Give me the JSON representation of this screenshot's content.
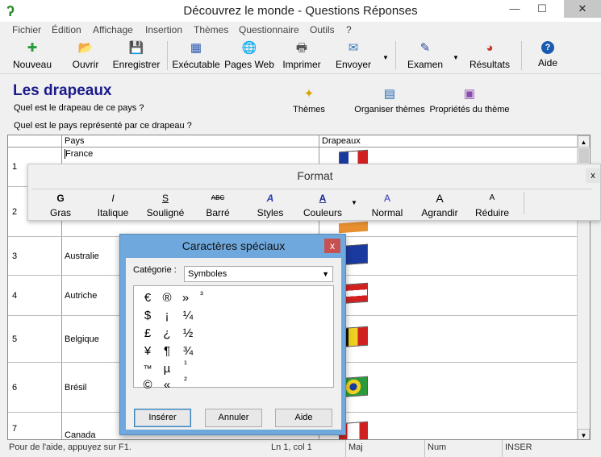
{
  "window": {
    "title": "Découvrez le monde - Questions Réponses",
    "minimize": "—",
    "maximize": "☐",
    "close": "✕"
  },
  "menu": [
    "Fichier",
    "Édition",
    "Affichage",
    "Insertion",
    "Thèmes",
    "Questionnaire",
    "Outils",
    "?"
  ],
  "toolbar": [
    {
      "label": "Nouveau",
      "icon": "new-icon",
      "glyph": "✚",
      "color": "#2a9a3a"
    },
    {
      "label": "Ouvrir",
      "icon": "open-folder-icon",
      "glyph": "📂",
      "color": "#d9a400"
    },
    {
      "label": "Enregistrer",
      "icon": "save-disk-icon",
      "glyph": "💾",
      "color": "#7b2a8a"
    },
    {
      "label": "Exécutable",
      "icon": "executable-icon",
      "glyph": "▦",
      "color": "#2a5ab0"
    },
    {
      "label": "Pages Web",
      "icon": "web-pages-icon",
      "glyph": "🌐",
      "color": "#1a6ab0"
    },
    {
      "label": "Imprimer",
      "icon": "printer-icon",
      "glyph": "🖶",
      "color": "#555"
    },
    {
      "label": "Envoyer",
      "icon": "send-mail-icon",
      "glyph": "✉",
      "color": "#3a7ac0"
    },
    {
      "label": "Examen",
      "icon": "exam-icon",
      "glyph": "✎",
      "color": "#2a4aa0"
    },
    {
      "label": "Résultats",
      "icon": "results-chart-icon",
      "glyph": "◕",
      "color": "#c03a2a"
    },
    {
      "label": "Aide",
      "icon": "help-icon",
      "glyph": "?",
      "color": "#1a5ab0"
    }
  ],
  "header": {
    "title": "Les drapeaux",
    "question1": "Quel est le drapeau de ce pays ?",
    "question2": "Quel est le pays représenté par ce drapeau ?",
    "buttons": [
      {
        "label": "Thèmes",
        "icon": "themes-icon",
        "glyph": "✦",
        "color": "#d9a400"
      },
      {
        "label": "Organiser thèmes",
        "icon": "organize-themes-icon",
        "glyph": "▤",
        "color": "#2a6ab0"
      },
      {
        "label": "Propriétés du thème",
        "icon": "theme-properties-icon",
        "glyph": "▣",
        "color": "#8a4ab0"
      }
    ]
  },
  "grid": {
    "columns": [
      "",
      "Pays",
      "Drapeaux"
    ],
    "rows": [
      {
        "num": "1",
        "pays": "France",
        "flag": "france-flag"
      },
      {
        "num": "2",
        "pays": "",
        "flag": "flag"
      },
      {
        "num": "3",
        "pays": "Australie",
        "flag": "australia-flag"
      },
      {
        "num": "4",
        "pays": "Autriche",
        "flag": "austria-flag"
      },
      {
        "num": "5",
        "pays": "Belgique",
        "flag": "belgium-flag"
      },
      {
        "num": "6",
        "pays": "Brésil",
        "flag": "brazil-flag"
      },
      {
        "num": "7",
        "pays": "Canada",
        "flag": "canada-flag"
      }
    ]
  },
  "status": {
    "help": "Pour de l'aide, appuyez sur F1.",
    "position": "Ln 1, col 1",
    "maj": "Maj",
    "num": "Num",
    "inser": "INSER"
  },
  "format": {
    "title": "Format",
    "close": "x",
    "tools": [
      {
        "label": "Gras",
        "glyph": "G",
        "icon": "bold-icon"
      },
      {
        "label": "Italique",
        "glyph": "I",
        "icon": "italic-icon"
      },
      {
        "label": "Souligné",
        "glyph": "S",
        "icon": "underline-icon"
      },
      {
        "label": "Barré",
        "glyph": "ABC",
        "icon": "strikethrough-icon"
      },
      {
        "label": "Styles",
        "glyph": "A",
        "icon": "styles-icon"
      },
      {
        "label": "Couleurs",
        "glyph": "A",
        "icon": "font-color-icon"
      },
      {
        "label": "Normal",
        "glyph": "A",
        "icon": "normal-size-icon"
      },
      {
        "label": "Agrandir",
        "glyph": "A",
        "icon": "grow-font-icon"
      },
      {
        "label": "Réduire",
        "glyph": "A",
        "icon": "shrink-font-icon"
      }
    ]
  },
  "dialog": {
    "title": "Caractères spéciaux",
    "close": "x",
    "category_label": "Catégorie :",
    "category_value": "Symboles",
    "symbols": [
      [
        "€",
        "®",
        "»",
        "³"
      ],
      [
        "$",
        "¡",
        "¼",
        ""
      ],
      [
        "£",
        "¿",
        "½",
        ""
      ],
      [
        "¥",
        "¶",
        "¾",
        ""
      ],
      [
        "™",
        "µ",
        "¹",
        ""
      ],
      [
        "©",
        "«",
        "²",
        ""
      ]
    ],
    "buttons": {
      "insert": "Insérer",
      "cancel": "Annuler",
      "help": "Aide"
    }
  }
}
